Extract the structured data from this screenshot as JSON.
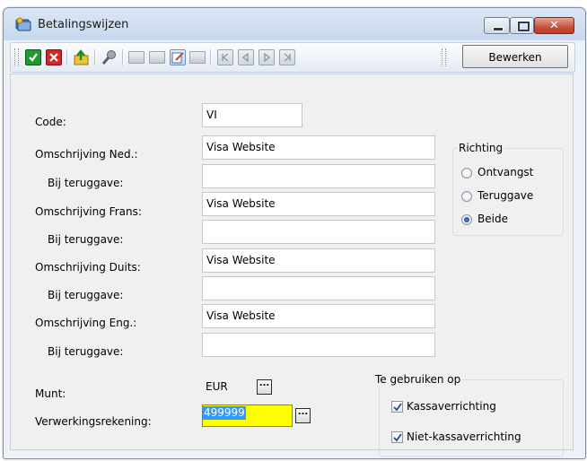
{
  "window": {
    "title": "Betalingswijzen",
    "close_glyph": "✕"
  },
  "toolbar": {
    "edit_button": "Bewerken",
    "icons": [
      "ok-icon",
      "cancel-icon",
      "export-icon",
      "search-icon",
      "folder-icon",
      "folder-copy-icon",
      "edit-icon",
      "folder-closed-icon",
      "first-icon",
      "previous-icon",
      "next-icon",
      "last-icon"
    ]
  },
  "form": {
    "code": {
      "label": "Code:",
      "value": "VI"
    },
    "omschrijving_ned": {
      "label": "Omschrijving Ned.:",
      "value": "Visa Website"
    },
    "ned_terug": {
      "label": "Bij teruggave:",
      "value": ""
    },
    "omschrijving_frans": {
      "label": "Omschrijving Frans:",
      "value": "Visa Website"
    },
    "frans_terug": {
      "label": "Bij teruggave:",
      "value": ""
    },
    "omschrijving_duits": {
      "label": "Omschrijving Duits:",
      "value": "Visa Website"
    },
    "duits_terug": {
      "label": "Bij teruggave:",
      "value": ""
    },
    "omschrijving_eng": {
      "label": "Omschrijving Eng.:",
      "value": "Visa Website"
    },
    "eng_terug": {
      "label": "Bij teruggave:",
      "value": ""
    },
    "munt": {
      "label": "Munt:",
      "value": "EUR"
    },
    "verwerkingsrekening": {
      "label": "Verwerkingsrekening:",
      "value": "499999",
      "highlight_color": "#ffff00"
    },
    "ellipsis": "..."
  },
  "richting": {
    "title": "Richting",
    "options": [
      {
        "label": "Ontvangst",
        "selected": false
      },
      {
        "label": "Teruggave",
        "selected": false
      },
      {
        "label": "Beide",
        "selected": true
      }
    ]
  },
  "te_gebruiken_op": {
    "title": "Te gebruiken op",
    "options": [
      {
        "label": "Kassaverrichting",
        "checked": true
      },
      {
        "label": "Niet-kassaverrichting",
        "checked": true
      }
    ]
  }
}
